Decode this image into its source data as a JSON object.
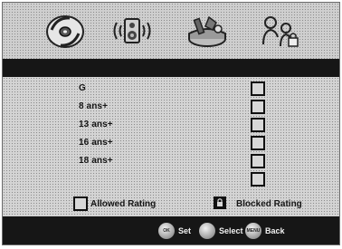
{
  "nav": {
    "icons": [
      "disc-icon",
      "speaker-icon",
      "settings-icon",
      "parental-lock-icon"
    ]
  },
  "ratings": [
    {
      "label": "G",
      "blocked": false
    },
    {
      "label": "8 ans+",
      "blocked": false
    },
    {
      "label": "13 ans+",
      "blocked": false
    },
    {
      "label": "16 ans+",
      "blocked": false
    },
    {
      "label": "18 ans+",
      "blocked": false
    }
  ],
  "legend": {
    "allowed_label": "Allowed Rating",
    "blocked_label": "Blocked Rating"
  },
  "hints": {
    "ok_button": "OK",
    "set_label": "Set",
    "select_label": "Select",
    "menu_button": "MENU",
    "back_label": "Back"
  }
}
